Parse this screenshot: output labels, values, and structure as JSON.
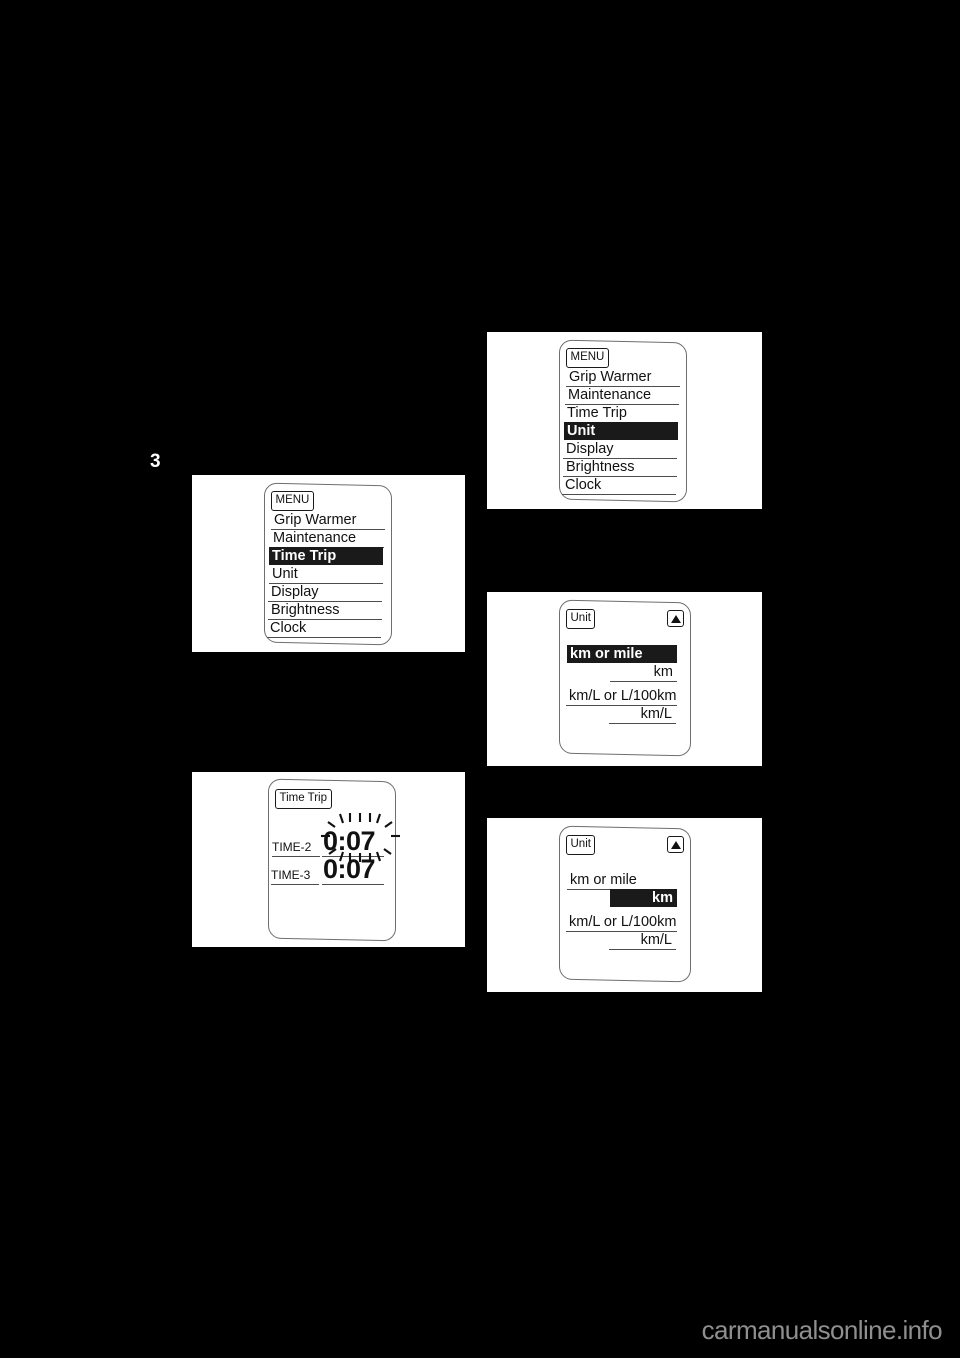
{
  "page": {
    "background_color": "#000000",
    "chapter_marker": "3",
    "watermark": "carmanualsonline.info"
  },
  "figures": [
    {
      "id": "fig-menu-time-trip",
      "name": "menu-screen-time-trip-selected",
      "screen_tag": "MENU",
      "items": [
        {
          "label": "Grip Warmer",
          "selected": false
        },
        {
          "label": "Maintenance",
          "selected": false
        },
        {
          "label": "Time Trip",
          "selected": true
        },
        {
          "label": "Unit",
          "selected": false
        },
        {
          "label": "Display",
          "selected": false
        },
        {
          "label": "Brightness",
          "selected": false
        },
        {
          "label": "Clock",
          "selected": false
        }
      ]
    },
    {
      "id": "fig-time-trip",
      "name": "time-trip-screen",
      "screen_tag": "Time Trip",
      "rows": [
        {
          "label": "TIME-2",
          "value": "0:07",
          "blinking": true
        },
        {
          "label": "TIME-3",
          "value": "0:07",
          "blinking": false
        }
      ]
    },
    {
      "id": "fig-menu-unit",
      "name": "menu-screen-unit-selected",
      "screen_tag": "MENU",
      "items": [
        {
          "label": "Grip Warmer",
          "selected": false
        },
        {
          "label": "Maintenance",
          "selected": false
        },
        {
          "label": "Time Trip",
          "selected": false
        },
        {
          "label": "Unit",
          "selected": true
        },
        {
          "label": "Display",
          "selected": false
        },
        {
          "label": "Brightness",
          "selected": false
        },
        {
          "label": "Clock",
          "selected": false
        }
      ]
    },
    {
      "id": "fig-unit-title-selected",
      "name": "unit-screen-title-highlighted",
      "screen_tag": "Unit",
      "arrow_icon": "up-arrow-icon",
      "rows": [
        {
          "label": "km or mile",
          "align": "left",
          "selected": true
        },
        {
          "label": "km",
          "align": "right",
          "selected": false
        },
        {
          "label": "km/L or L/100km",
          "align": "left",
          "selected": false
        },
        {
          "label": "km/L",
          "align": "right",
          "selected": false
        }
      ]
    },
    {
      "id": "fig-unit-value-selected",
      "name": "unit-screen-value-highlighted",
      "screen_tag": "Unit",
      "arrow_icon": "up-arrow-icon",
      "rows": [
        {
          "label": "km or mile",
          "align": "left",
          "selected": false
        },
        {
          "label": "km",
          "align": "right",
          "selected": true
        },
        {
          "label": "km/L or L/100km",
          "align": "left",
          "selected": false
        },
        {
          "label": "km/L",
          "align": "right",
          "selected": false
        }
      ]
    }
  ]
}
